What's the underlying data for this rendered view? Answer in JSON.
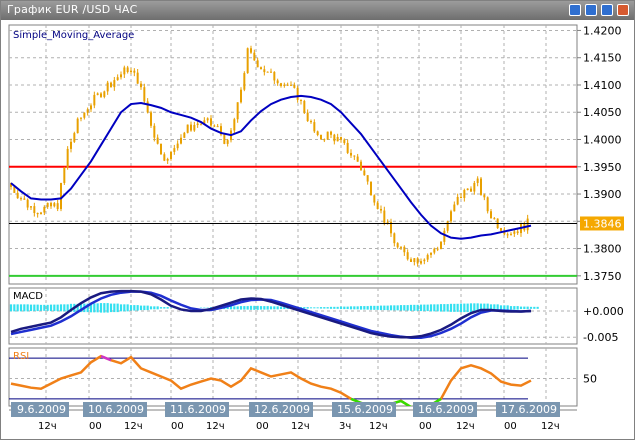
{
  "window": {
    "title": "График EUR /USD  ЧАС",
    "buttons": [
      "minimize-icon",
      "restore-icon",
      "maximize-icon",
      "close-icon"
    ]
  },
  "colors": {
    "candles": "#e8a000",
    "sma": "#0000c0",
    "resistance": "#ff0000",
    "support": "#33cc33",
    "macd_main": "#1a1a80",
    "macd_signal": "#1f2fd0",
    "macd_hist": "#33e0f0",
    "rsi": "#f08018",
    "rsi_overbought": "#cc33cc",
    "rsi_oversold": "#33dd00",
    "date_box": "#7a96b0",
    "price_tag": "#f5a800"
  },
  "chart_data": [
    {
      "type": "candlestick",
      "title": "Simple_Moving_Average",
      "ylim": [
        1.3735,
        1.421
      ],
      "y_ticks": [
        "1.4200",
        "1.4150",
        "1.4100",
        "1.4050",
        "1.4000",
        "1.3950",
        "1.3900",
        "1.3850",
        "1.3800",
        "1.3750"
      ],
      "current_price": "1.3846",
      "current_price_value": 1.3846,
      "horizontal_lines": [
        {
          "value": 1.395,
          "color": "#ff0000"
        },
        {
          "value": 1.375,
          "color": "#33cc33"
        }
      ],
      "closes": [
        1.392,
        1.39,
        1.388,
        1.387,
        1.3875,
        1.388,
        1.398,
        1.403,
        1.406,
        1.408,
        1.41,
        1.4115,
        1.413,
        1.411,
        1.405,
        1.399,
        1.396,
        1.4,
        1.402,
        1.403,
        1.403,
        1.402,
        1.399,
        1.406,
        1.416,
        1.414,
        1.412,
        1.411,
        1.41,
        1.408,
        1.404,
        1.4,
        1.401,
        1.4,
        1.398,
        1.396,
        1.392,
        1.388,
        1.384,
        1.38,
        1.3785,
        1.378,
        1.379,
        1.38,
        1.385,
        1.389,
        1.391,
        1.392,
        1.387,
        1.3845,
        1.383,
        1.3835,
        1.3846
      ],
      "sma": [
        1.392,
        1.3905,
        1.3892,
        1.389,
        1.389,
        1.3892,
        1.391,
        1.3935,
        1.396,
        1.399,
        1.402,
        1.405,
        1.4065,
        1.4067,
        1.4063,
        1.4058,
        1.405,
        1.4045,
        1.404,
        1.4032,
        1.402,
        1.4012,
        1.4008,
        1.4015,
        1.4035,
        1.4052,
        1.4065,
        1.4073,
        1.4078,
        1.408,
        1.4078,
        1.4073,
        1.4065,
        1.405,
        1.403,
        1.401,
        1.3985,
        1.396,
        1.3935,
        1.391,
        1.3885,
        1.3862,
        1.3842,
        1.3828,
        1.382,
        1.3818,
        1.382,
        1.3824,
        1.3826,
        1.383,
        1.3834,
        1.3838,
        1.3842
      ]
    },
    {
      "type": "line",
      "title": "MACD",
      "ylim": [
        -0.0063,
        0.0044
      ],
      "y_ticks": [
        "+0.000",
        "-0.005"
      ],
      "y_tick_values": [
        0,
        -0.005
      ],
      "main": [
        -0.004,
        -0.0034,
        -0.003,
        -0.0026,
        -0.0022,
        -0.0012,
        0.0002,
        0.0015,
        0.0026,
        0.0034,
        0.0037,
        0.0038,
        0.0038,
        0.0037,
        0.0032,
        0.0022,
        0.001,
        0.0003,
        0.0,
        0.0,
        0.0004,
        0.001,
        0.0016,
        0.0022,
        0.0024,
        0.0023,
        0.0018,
        0.0012,
        0.0006,
        0.0,
        -0.0006,
        -0.0012,
        -0.0018,
        -0.0024,
        -0.003,
        -0.0036,
        -0.0042,
        -0.0046,
        -0.0049,
        -0.005,
        -0.005,
        -0.0048,
        -0.0043,
        -0.0036,
        -0.0026,
        -0.0014,
        -0.0004,
        0.0002,
        0.0002,
        0.0,
        -0.0001,
        -0.0001,
        0.0
      ],
      "signal": [
        -0.0044,
        -0.004,
        -0.0036,
        -0.0032,
        -0.0028,
        -0.002,
        -0.001,
        0.0002,
        0.0014,
        0.0024,
        0.0031,
        0.0035,
        0.0037,
        0.0037,
        0.0035,
        0.0029,
        0.002,
        0.0012,
        0.0005,
        0.0002,
        0.0002,
        0.0006,
        0.0011,
        0.0017,
        0.0021,
        0.0022,
        0.0021,
        0.0016,
        0.001,
        0.0004,
        -0.0002,
        -0.0008,
        -0.0014,
        -0.002,
        -0.0026,
        -0.0032,
        -0.0038,
        -0.0042,
        -0.0046,
        -0.0049,
        -0.0051,
        -0.0051,
        -0.0048,
        -0.0042,
        -0.0034,
        -0.0024,
        -0.0012,
        -0.0003,
        0.0001,
        0.0001,
        0.0,
        -0.0001,
        0.0
      ],
      "histogram": [
        0.001,
        0.001,
        0.0009,
        0.0008,
        0.0009,
        0.001,
        0.0012,
        0.0013,
        0.0014,
        0.0015,
        0.0013,
        0.001,
        0.0007,
        0.0005,
        0.0002,
        -0.0001,
        -0.0003,
        -0.0004,
        -0.0004,
        -0.0003,
        -0.0001,
        0.0001,
        0.0002,
        0.0003,
        0.0004,
        0.0003,
        0.0002,
        0.0001,
        0.0,
        -0.0001,
        -0.0002,
        -0.0001,
        0.0,
        0.0001,
        0.0002,
        0.0003,
        0.0004,
        0.0005,
        0.0006,
        0.0007,
        0.0008,
        0.0009,
        0.001,
        0.0011,
        0.0012,
        0.0013,
        0.0014,
        0.0013,
        0.001,
        0.0006,
        0.0003,
        0.0001,
        0.0
      ]
    },
    {
      "type": "line",
      "title": "RSI",
      "ylim": [
        23,
        80
      ],
      "y_ticks": [
        "50"
      ],
      "y_tick_values": [
        50
      ],
      "levels": [
        70,
        30
      ],
      "values": [
        45,
        43,
        41,
        40,
        45,
        50,
        53,
        56,
        66,
        72,
        68,
        65,
        71,
        60,
        56,
        52,
        48,
        40,
        44,
        47,
        50,
        48,
        42,
        48,
        60,
        56,
        52,
        54,
        56,
        50,
        45,
        42,
        40,
        36,
        30,
        26,
        24,
        22,
        25,
        28,
        22,
        20,
        24,
        30,
        48,
        60,
        63,
        60,
        55,
        47,
        44,
        43,
        48
      ]
    }
  ],
  "time_axis": {
    "dates": [
      "9.6.2009",
      "10.6.2009",
      "11.6.2009",
      "12.6.2009",
      "15.6.2009",
      "16.6.2009",
      "17.6.2009"
    ],
    "hours": [
      "12ч",
      "00",
      "12ч",
      "00",
      "12ч",
      "00",
      "12ч",
      "3ч",
      "12ч",
      "00",
      "12ч",
      "00",
      "12ч"
    ]
  }
}
